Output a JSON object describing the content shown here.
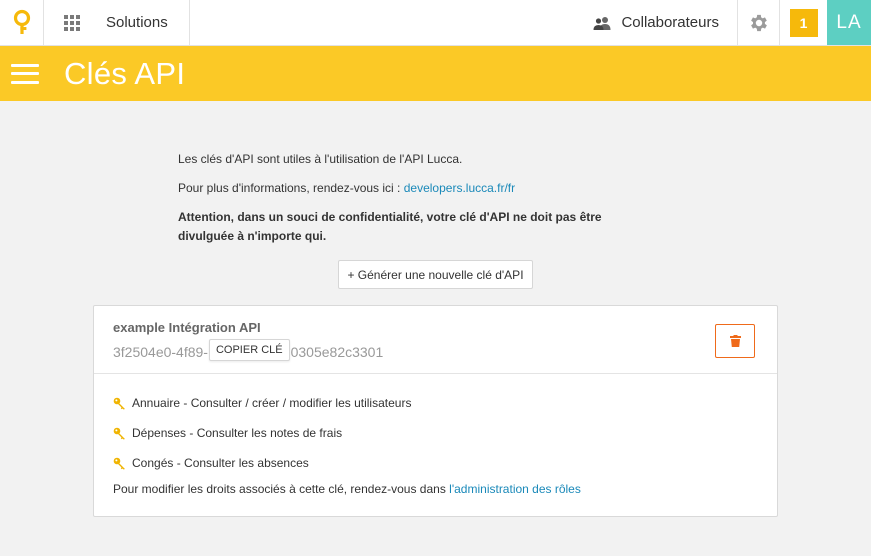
{
  "topbar": {
    "solutions_label": "Solutions",
    "collaborators_label": "Collaborateurs",
    "notification_count": "1",
    "avatar_initials": "LA"
  },
  "header": {
    "title": "Clés API"
  },
  "intro": {
    "line1": "Les clés d'API sont utiles à l'utilisation de l'API Lucca.",
    "line2_prefix": "Pour plus d'informations, rendez-vous ici : ",
    "line2_link": "developers.lucca.fr/fr",
    "warning": "Attention, dans un souci de confidentialité, votre clé d'API ne doit pas être divulguée à n'importe qui."
  },
  "generate_button_label": "+ Générer une nouvelle clé d'API",
  "api_key": {
    "name": "example Intégration API",
    "value_start": "3f2504e0-4f89-",
    "copy_label": "COPIER CLÉ",
    "value_end": "0305e82c3301",
    "permissions": [
      "Annuaire - Consulter / créer / modifier les utilisateurs",
      "Dépenses - Consulter les notes de frais",
      "Congés - Consulter les absences"
    ],
    "footnote_prefix": "Pour modifier les droits associés à cette clé, rendez-vous dans ",
    "footnote_link": "l'administration des rôles"
  },
  "colors": {
    "header_yellow": "#fbc926",
    "notification": "#f6b90b",
    "avatar": "#5dcfc2",
    "link": "#1a89b9",
    "delete": "#ef6a1a"
  }
}
